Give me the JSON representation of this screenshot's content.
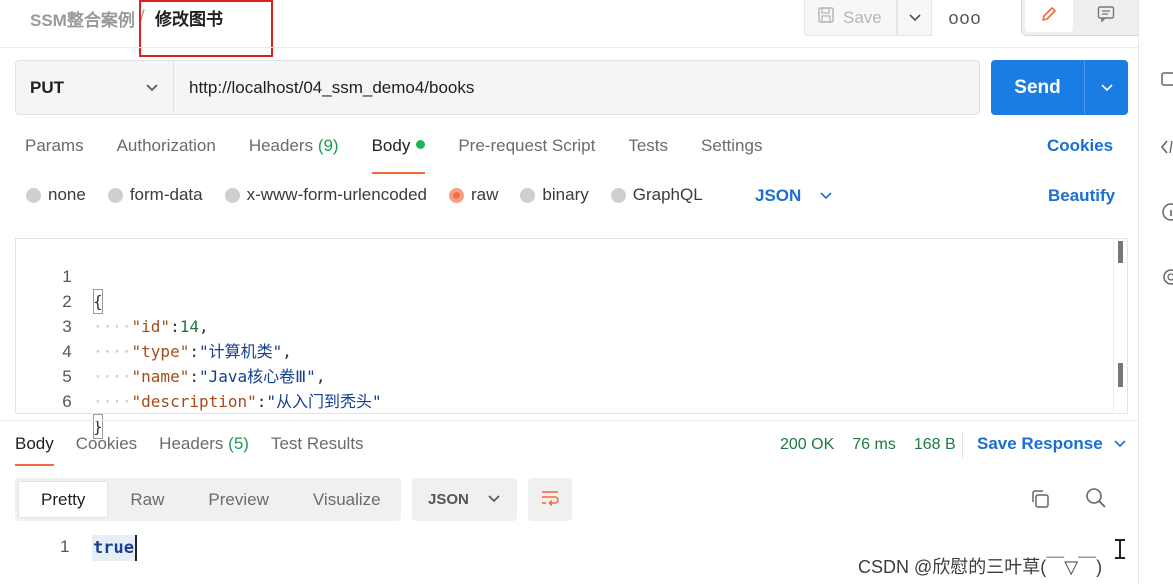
{
  "header": {
    "breadcrumb_parent": "SSM整合案例",
    "breadcrumb_sep": "/",
    "request_name": "修改图书",
    "save_label": "Save",
    "more_label": "ooo"
  },
  "request": {
    "method": "PUT",
    "url": "http://localhost/04_ssm_demo4/books",
    "send_label": "Send"
  },
  "request_tabs": {
    "params": "Params",
    "authorization": "Authorization",
    "headers": "Headers",
    "headers_count": "(9)",
    "body": "Body",
    "pre_request": "Pre-request Script",
    "tests": "Tests",
    "settings": "Settings",
    "cookies": "Cookies"
  },
  "body_types": {
    "none": "none",
    "form_data": "form-data",
    "urlencoded": "x-www-form-urlencoded",
    "raw": "raw",
    "binary": "binary",
    "graphql": "GraphQL",
    "selected_format": "JSON",
    "beautify": "Beautify"
  },
  "editor": {
    "line_numbers": [
      "1",
      "2",
      "3",
      "4",
      "5",
      "6"
    ],
    "open_brace": "{",
    "close_brace": "}",
    "indent": "····",
    "fields": [
      {
        "key": "\"id\"",
        "value": "14",
        "comma": ","
      },
      {
        "key": "\"type\"",
        "value": "\"计算机类\"",
        "comma": ","
      },
      {
        "key": "\"name\"",
        "value": "\"Java核心卷Ⅲ\"",
        "comma": ","
      },
      {
        "key": "\"description\"",
        "value": "\"从入门到秃头\"",
        "comma": ""
      }
    ]
  },
  "response": {
    "tabs": {
      "body": "Body",
      "cookies": "Cookies",
      "headers": "Headers",
      "headers_count": "(5)",
      "test_results": "Test Results"
    },
    "status": "200 OK",
    "time": "76 ms",
    "size": "168 B",
    "save_response": "Save Response",
    "views": [
      "Pretty",
      "Raw",
      "Preview",
      "Visualize"
    ],
    "format": "JSON",
    "line_number": "1",
    "body_value": "true"
  },
  "watermark": "CSDN @欣慰的三叶草(￣▽￣)"
}
